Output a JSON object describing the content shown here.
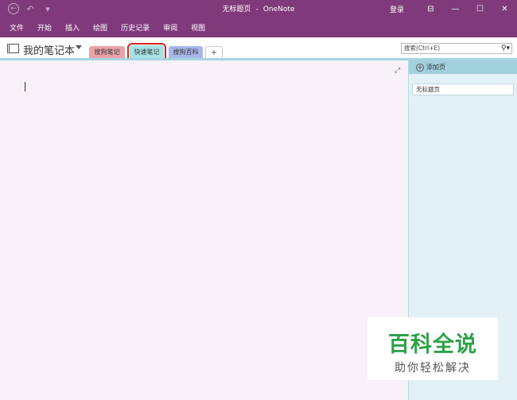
{
  "window": {
    "title": "无标题页",
    "separator": "-",
    "app": "OneNote",
    "login": "登录",
    "controls": {
      "ribbon_display": "⊟",
      "minimize": "—",
      "maximize": "☐",
      "close": "✕"
    }
  },
  "qat": {
    "back": "←",
    "undo": "↶",
    "customize": "▾"
  },
  "ribbon": {
    "tabs": [
      "文件",
      "开始",
      "插入",
      "绘图",
      "历史记录",
      "审阅",
      "视图"
    ]
  },
  "notebook": {
    "name": "我的笔记本",
    "sections": [
      {
        "label": "搜狗笔记",
        "color": "#e9a3a8"
      },
      {
        "label": "快速笔记",
        "color": "#a6e3e4",
        "active": true
      },
      {
        "label": "搜狗百科",
        "color": "#a8b6ea"
      }
    ],
    "add_section": "+"
  },
  "search": {
    "placeholder": "搜索(Ctrl+E)",
    "icon": "⚲▾"
  },
  "pages": {
    "add_page": "添加页",
    "items": [
      "无标题页"
    ]
  },
  "watermark": {
    "title": "百科全说",
    "subtitle": "助你轻松解决"
  },
  "colors": {
    "accent": "#80397b",
    "canvas": "#f7f1f8",
    "pane": "#e3f1f6",
    "watermark_green": "#2ea148"
  }
}
